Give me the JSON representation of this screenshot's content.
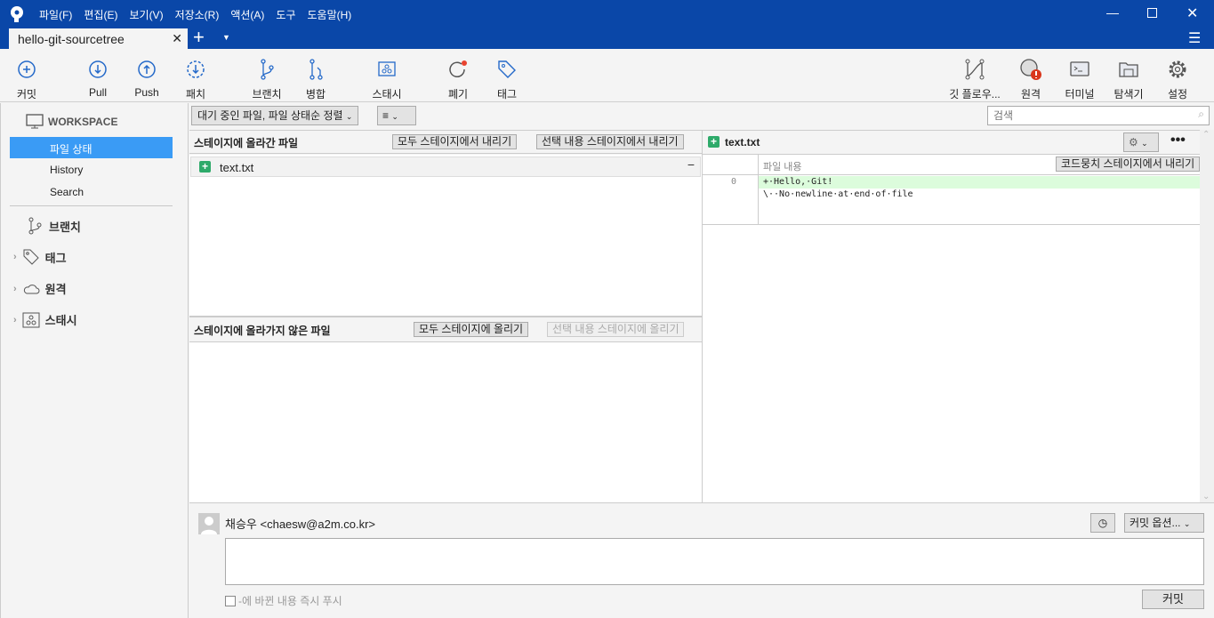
{
  "app": {
    "menu": [
      "파일(F)",
      "편집(E)",
      "보기(V)",
      "저장소(R)",
      "액션(A)",
      "도구",
      "도움말(H)"
    ],
    "tab_title": "hello-git-sourcetree",
    "accent": "#0a47a8",
    "selection": "#3a9bf5"
  },
  "toolbar": {
    "left": [
      {
        "label": "커밋",
        "icon": "plus-circle-icon"
      },
      {
        "label": "Pull",
        "icon": "arrow-down-circle-icon"
      },
      {
        "label": "Push",
        "icon": "arrow-up-circle-icon"
      },
      {
        "label": "패치",
        "icon": "fetch-icon"
      },
      {
        "label": "브랜치",
        "icon": "branch-icon"
      },
      {
        "label": "병합",
        "icon": "merge-icon"
      },
      {
        "label": "스태시",
        "icon": "stash-icon"
      },
      {
        "label": "폐기",
        "icon": "discard-icon"
      },
      {
        "label": "태그",
        "icon": "tag-icon"
      }
    ],
    "right": [
      {
        "label": "깃 플로우...",
        "icon": "git-flow-icon"
      },
      {
        "label": "원격",
        "icon": "globe-icon"
      },
      {
        "label": "터미널",
        "icon": "terminal-icon"
      },
      {
        "label": "탐색기",
        "icon": "folder-icon"
      },
      {
        "label": "설정",
        "icon": "gear-icon"
      }
    ]
  },
  "sidebar": {
    "workspace": "WORKSPACE",
    "items": [
      "파일 상태",
      "History",
      "Search"
    ],
    "groups": [
      "브랜치",
      "태그",
      "원격",
      "스태시"
    ]
  },
  "filter": {
    "sort": "대기 중인 파일, 파일 상태순 정렬",
    "search_placeholder": "검색"
  },
  "staged": {
    "title": "스테이지에 올라간 파일",
    "unstage_all": "모두 스테이지에서 내리기",
    "unstage_selected": "선택 내용 스테이지에서 내리기",
    "files": [
      "text.txt"
    ]
  },
  "unstaged": {
    "title": "스테이지에 올라가지 않은 파일",
    "stage_all": "모두 스테이지에 올리기",
    "stage_selected": "선택 내용 스테이지에 올리기"
  },
  "diff": {
    "file": "text.txt",
    "header": "파일 내용",
    "hunk_button": "코드뭉치 스테이지에서 내리기",
    "line_no": "0",
    "lines": [
      "+·Hello,·Git!",
      "\\··No·newline·at·end·of·file"
    ]
  },
  "commit": {
    "author": "채승우 <chaesw@a2m.co.kr>",
    "options": "커밋 옵션...",
    "push_label": "-에 바뀐 내용 즉시 푸시",
    "commit_button": "커밋",
    "message": ""
  }
}
